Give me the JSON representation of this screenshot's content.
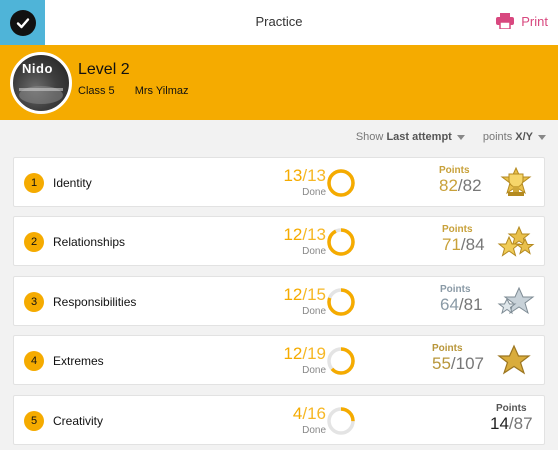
{
  "header": {
    "title": "Practice",
    "print_label": "Print",
    "accent": "#d8487f"
  },
  "profile": {
    "avatar_text": "Nido",
    "level": "Level 2",
    "class_name": "Class 5",
    "teacher": "Mrs Yilmaz"
  },
  "filters": {
    "show_label": "Show",
    "show_value": "Last attempt",
    "points_label": "points",
    "points_value": "X/Y"
  },
  "topics": [
    {
      "num": "1",
      "name": "Identity",
      "done": "13",
      "total": "/13",
      "done_label": "Done",
      "fraction": 1.0,
      "points_label": "Points",
      "points": "82",
      "points_total": "/82",
      "award": "trophy-gold-icon",
      "points_color": "#c8a13a"
    },
    {
      "num": "2",
      "name": "Relationships",
      "done": "12",
      "total": "/13",
      "done_label": "Done",
      "fraction": 0.923,
      "points_label": "Points",
      "points": "71",
      "points_total": "/84",
      "award": "two-gold-stars-icon",
      "points_color": "#c8a13a"
    },
    {
      "num": "3",
      "name": "Responsibilities",
      "done": "12",
      "total": "/15",
      "done_label": "Done",
      "fraction": 0.8,
      "points_label": "Points",
      "points": "64",
      "points_total": "/81",
      "award": "silver-star-icon",
      "points_color": "#8a9aa6"
    },
    {
      "num": "4",
      "name": "Extremes",
      "done": "12",
      "total": "/19",
      "done_label": "Done",
      "fraction": 0.632,
      "points_label": "Points",
      "points": "55",
      "points_total": "/107",
      "award": "gold-star-icon",
      "points_color": "#b8963a"
    },
    {
      "num": "5",
      "name": "Creativity",
      "done": "4",
      "total": "/16",
      "done_label": "Done",
      "fraction": 0.25,
      "points_label": "Points",
      "points": "14",
      "points_total": "/87",
      "award": "",
      "points_color": "#444444"
    }
  ],
  "colors": {
    "orange": "#f5ab00",
    "checkbox_bg": "#4fb4d8"
  }
}
